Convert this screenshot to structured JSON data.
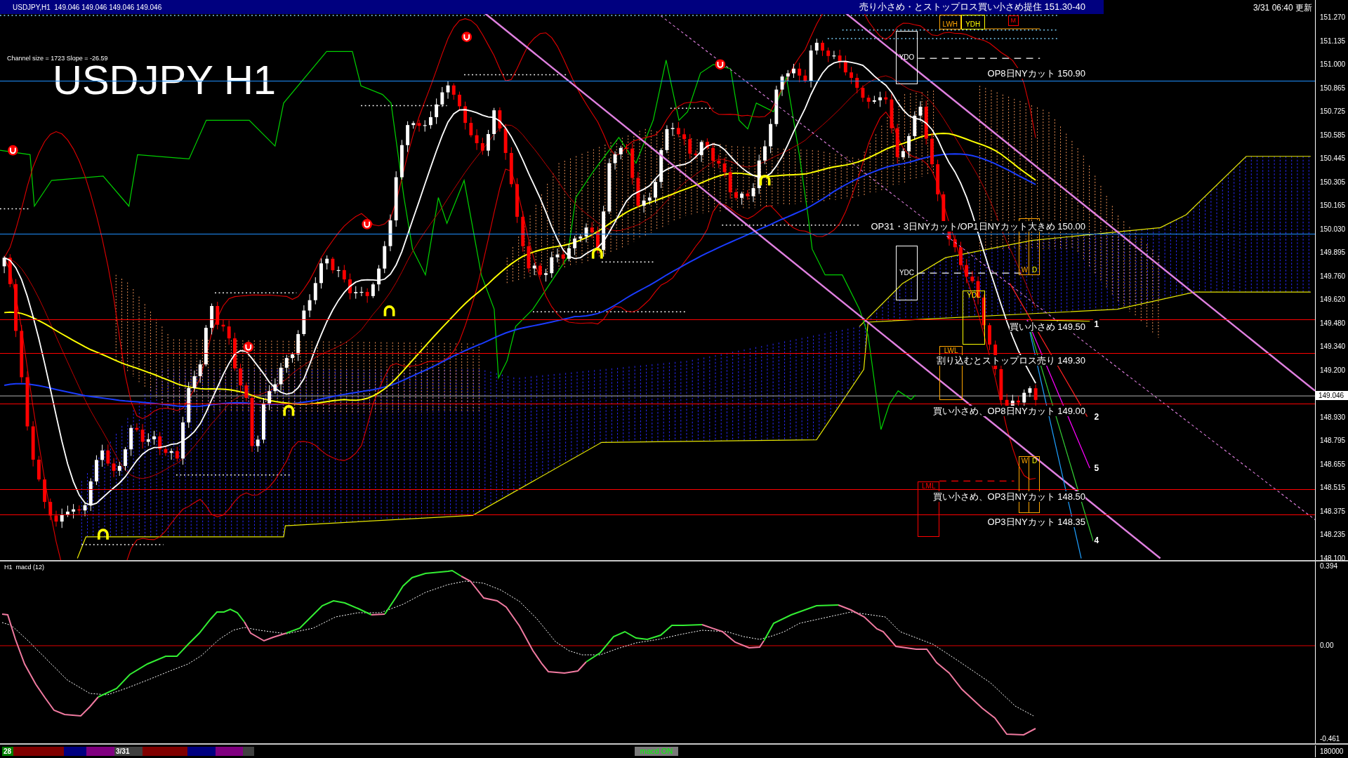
{
  "title_bar": {
    "title": "USDJPY,H1  149.046 149.046 149.046 149.046",
    "note": "売り小さめ・とストップロス買い小さめ提住 151.30-40"
  },
  "updated": "3/31 06:40 更新",
  "price_chart": {
    "channel_info": "Channel size = 1723 Slope = -26.59",
    "symbol_label": "USDJPY H1",
    "axis_labels": [
      "151.270",
      "151.135",
      "151.000",
      "150.865",
      "150.725",
      "150.585",
      "150.445",
      "150.305",
      "150.165",
      "150.030",
      "149.895",
      "149.760",
      "149.620",
      "149.480",
      "149.340",
      "149.200",
      "148.930",
      "148.795",
      "148.655",
      "148.515",
      "148.375",
      "148.235",
      "148.100"
    ],
    "current_price": "149.046",
    "level_lines": [
      {
        "label": "OP8日NYカット 150.90",
        "color": "#1e90ff"
      },
      {
        "label": "OP31・3日NYカット/OP1日NYカット大きめ 150.00",
        "color": "#1e90ff"
      },
      {
        "label": "買い小さめ 149.50",
        "color": "#ff0000"
      },
      {
        "label": "割り込むとストップロス売り 149.30",
        "color": "#ff0000"
      },
      {
        "label": "買い小さめ、OP8日NYカット 149.00",
        "color": "#ff0000"
      },
      {
        "label": "買い小さめ、OP3日NYカット 148.50",
        "color": "#ff0000"
      },
      {
        "label": "OP3日NYカット 148.35",
        "color": "#ff0000"
      }
    ],
    "level_boxes": [
      {
        "kind": "single",
        "labels": [
          "LWH"
        ],
        "color": "#ffa500"
      },
      {
        "kind": "single",
        "labels": [
          "YDH"
        ],
        "color": "#ffff00"
      },
      {
        "kind": "single",
        "labels": [
          "M"
        ],
        "color": "#ff0000"
      },
      {
        "kind": "single",
        "labels": [
          "YDO"
        ],
        "color": "#ffffff"
      },
      {
        "kind": "split",
        "labels": [
          "W",
          "D"
        ],
        "color": "#ffa500"
      },
      {
        "kind": "single",
        "labels": [
          "YDC"
        ],
        "color": "#ffffff"
      },
      {
        "kind": "single",
        "labels": [
          "YDL"
        ],
        "color": "#ffff00"
      },
      {
        "kind": "single",
        "labels": [
          "LWL"
        ],
        "color": "#ffa500"
      },
      {
        "kind": "split",
        "labels": [
          "W",
          "D"
        ],
        "color": "#ffa500"
      },
      {
        "kind": "single",
        "labels": [
          "LML"
        ],
        "color": "#ff0000"
      }
    ],
    "projection_labels": [
      "1",
      "2",
      "5",
      "4"
    ]
  },
  "macd_panel": {
    "title": "H1  macd (12)",
    "axis_labels": [
      "0.394",
      "0.00",
      "-0.461"
    ]
  },
  "bottom_bar": {
    "segments": [
      {
        "label": "28",
        "color": "#008000"
      },
      {
        "color": "#800000"
      },
      {
        "color": "#000080"
      },
      {
        "color": "#800080"
      },
      {
        "label": "3/31",
        "color": "#404040"
      },
      {
        "color": "#800000"
      },
      {
        "color": "#000080"
      },
      {
        "color": "#800080"
      },
      {
        "color": "#404040"
      }
    ],
    "button": "macd ON",
    "volume": "180000"
  }
}
